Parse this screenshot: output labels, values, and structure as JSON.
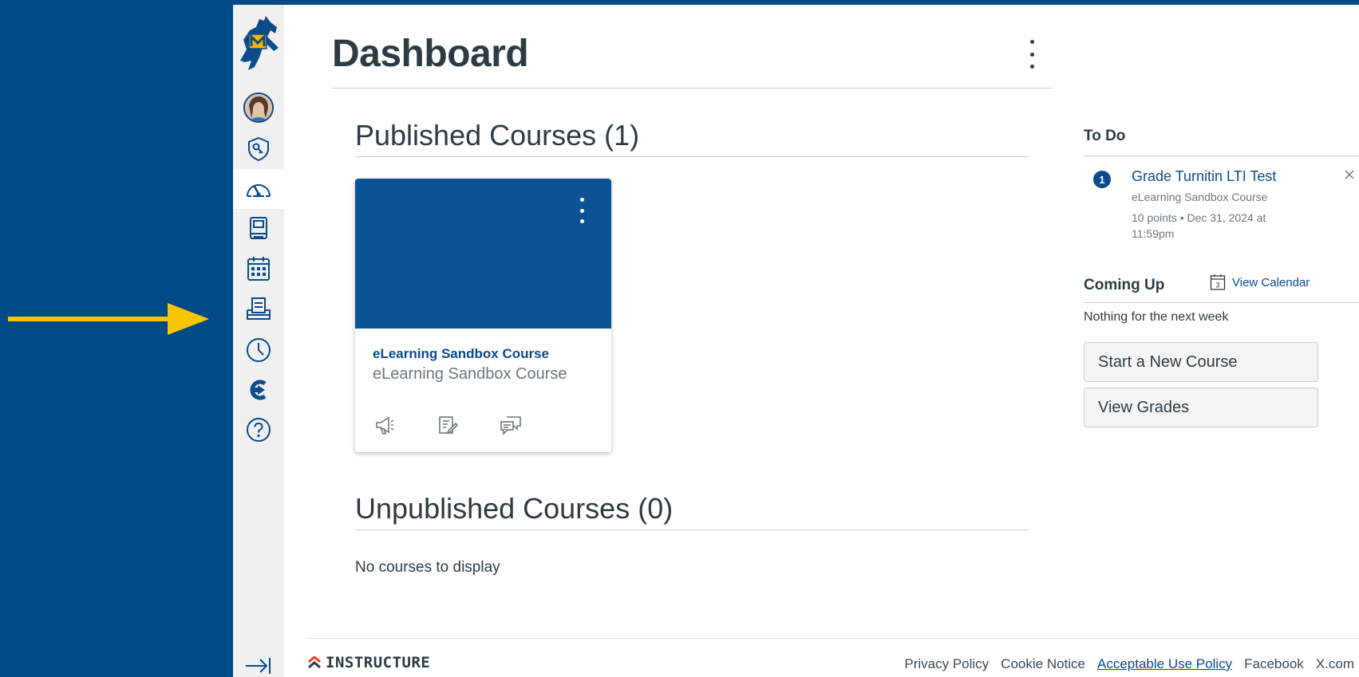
{
  "page": {
    "title": "Dashboard"
  },
  "published": {
    "heading": "Published Courses (1)",
    "courses": [
      {
        "name": "eLearning Sandbox Course",
        "code": "eLearning Sandbox Course",
        "color": "#0b5394"
      }
    ]
  },
  "unpublished": {
    "heading": "Unpublished Courses (0)",
    "empty_text": "No courses to display"
  },
  "sidebar": {
    "todo_title": "To Do",
    "todo_items": [
      {
        "badge": "1",
        "title": "Grade Turnitin LTI Test",
        "course": "eLearning Sandbox Course",
        "meta": "10 points • Dec 31, 2024 at 11:59pm"
      }
    ],
    "coming_up_title": "Coming Up",
    "view_calendar": "View Calendar",
    "calendar_icon_day": "3",
    "coming_up_empty": "Nothing for the next week",
    "start_course_button": "Start a New Course",
    "view_grades_button": "View Grades"
  },
  "footer": {
    "brand": "INSTRUCTURE",
    "links": [
      "Privacy Policy",
      "Cookie Notice",
      "Acceptable Use Policy",
      "Facebook",
      "X.com"
    ]
  },
  "global_nav": {
    "items": [
      "logo",
      "account",
      "admin",
      "dashboard",
      "courses",
      "calendar",
      "inbox",
      "history",
      "studio",
      "help"
    ],
    "active": "dashboard"
  },
  "colors": {
    "background": "#004a85",
    "accent": "#0b4a8b",
    "course_card": "#0b5394",
    "arrow": "#f7c600",
    "logo_gold": "#f2b705"
  }
}
